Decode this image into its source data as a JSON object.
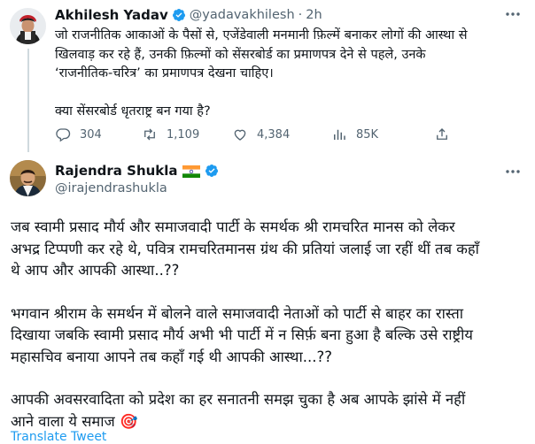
{
  "tweet1": {
    "name": "Akhilesh Yadav",
    "handle": "@yadavakhilesh",
    "separator": "·",
    "time": "2h",
    "text_lines": [
      "जो राजनीतिक आकाओं के पैसों से, एजेंडेवाली मनमानी फ़िल्में बनाकर लोगों की आस्था से",
      "खिलवाड़ कर रहे हैं, उनकी फ़िल्मों को सेंसरबोर्ड  का प्रमाणपत्र देने से पहले, उनके",
      "‘राजनीतिक-चरित्र’ का प्रमाणपत्र देखना चाहिए।"
    ],
    "question": "क्या सेंसरबोर्ड धृतराष्ट्र बन गया है?",
    "replies": "304",
    "retweets": "1,109",
    "likes": "4,384",
    "views": "85K"
  },
  "tweet2": {
    "name": "Rajendra Shukla",
    "handle": "@irajendrashukla",
    "flag": "🇮🇳",
    "para1": [
      "जब स्वामी प्रसाद मौर्य और समाजवादी पार्टी के समर्थक श्री रामचरित मानस को लेकर",
      "अभद्र टिप्पणी कर रहे थे, पवित्र रामचरितमानस ग्रंथ की प्रतियां जलाई जा रहीं थीं तब कहाँ",
      "थे आप और आपकी आस्था..??"
    ],
    "para2": [
      "भगवान श्रीराम के समर्थन में बोलने वाले समाजवादी नेताओं को पार्टी से बाहर का रास्ता",
      "दिखाया जबकि स्वामी प्रसाद मौर्य अभी भी पार्टी में न सिर्फ़ बना हुआ है बल्कि उसे राष्ट्रीय",
      "महासचिव बनाया आपने तब कहाँ गई थी आपकी आस्था...??"
    ],
    "para3": [
      "आपकी अवसरवादिता को प्रदेश का हर सनातनी समझ चुका है अब आपके झांसे में नहीं",
      "आने वाला ये समाज 🎯"
    ],
    "translate": "Translate Tweet"
  },
  "more_icon": "more-dots-icon",
  "colors": {
    "text": "#0f1419",
    "muted": "#536471",
    "verified": "#1d9bf0",
    "link": "#1d9bf0",
    "line": "#cfd9de"
  }
}
